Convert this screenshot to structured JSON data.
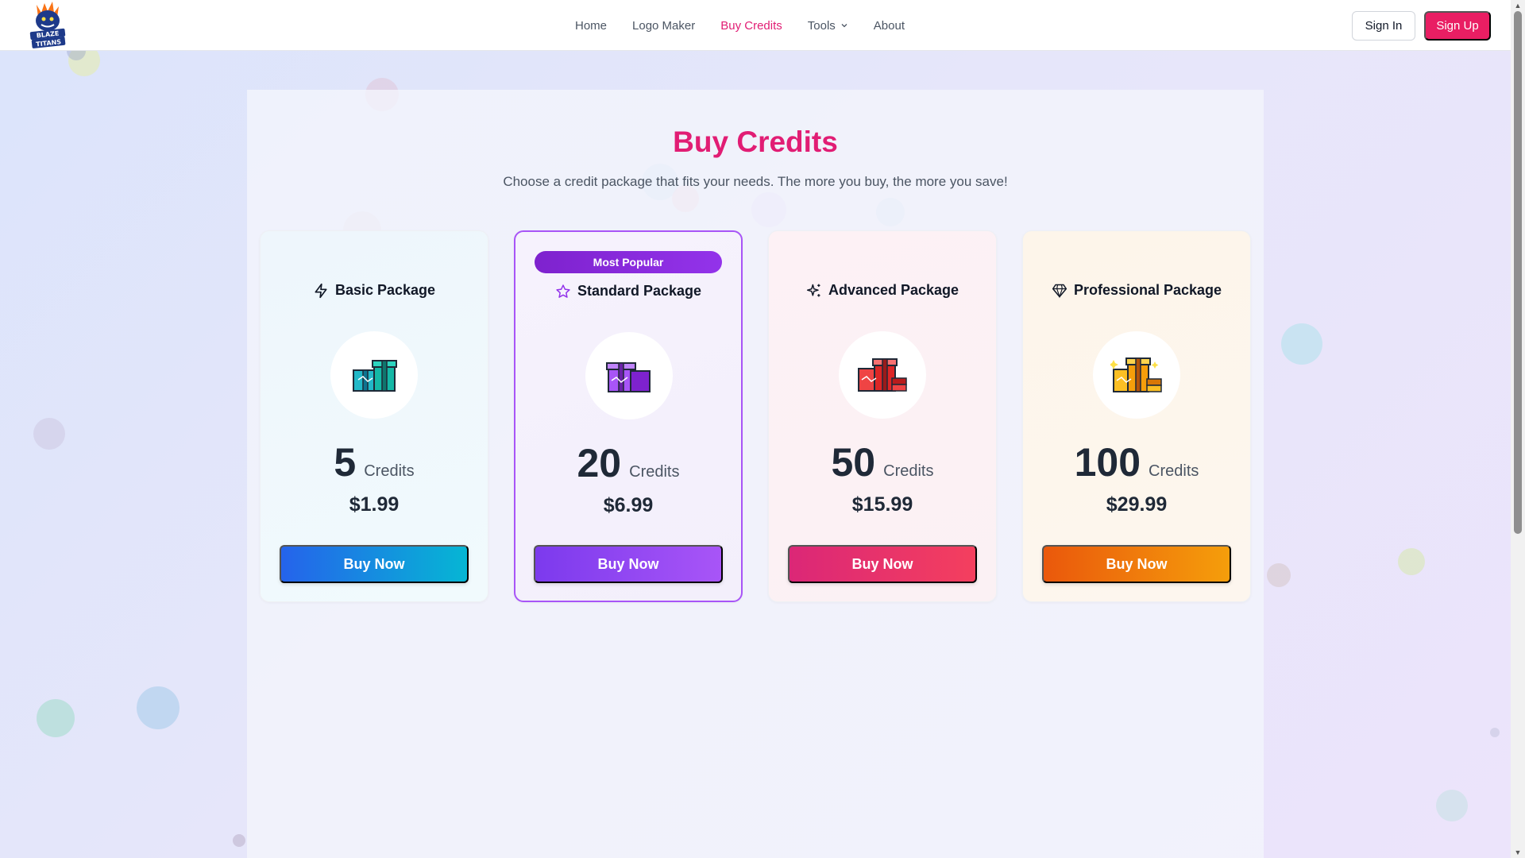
{
  "nav": {
    "logo_alt": "Blaze Titans",
    "links": [
      {
        "label": "Home"
      },
      {
        "label": "Logo Maker"
      },
      {
        "label": "Buy Credits"
      },
      {
        "label": "Tools"
      },
      {
        "label": "About"
      }
    ],
    "sign_in": "Sign In",
    "sign_up": "Sign Up"
  },
  "page": {
    "title": "Buy Credits",
    "subtitle": "Choose a credit package that fits your needs. The more you buy, the more you save!"
  },
  "packages": [
    {
      "name": "Basic Package",
      "icon": "lightning-icon",
      "credits": "5",
      "credits_label": "Credits",
      "price": "$1.99",
      "button": "Buy Now",
      "accent": "#2563eb"
    },
    {
      "name": "Standard Package",
      "icon": "star-icon",
      "badge": "Most Popular",
      "credits": "20",
      "credits_label": "Credits",
      "price": "$6.99",
      "button": "Buy Now",
      "accent": "#9333ea"
    },
    {
      "name": "Advanced Package",
      "icon": "sparkles-icon",
      "credits": "50",
      "credits_label": "Credits",
      "price": "$15.99",
      "button": "Buy Now",
      "accent": "#e11d48"
    },
    {
      "name": "Professional Package",
      "icon": "diamond-icon",
      "credits": "100",
      "credits_label": "Credits",
      "price": "$29.99",
      "button": "Buy Now",
      "accent": "#ea580c"
    }
  ],
  "colors": {
    "brand": "#e91e63",
    "active_nav": "#e11d74"
  }
}
